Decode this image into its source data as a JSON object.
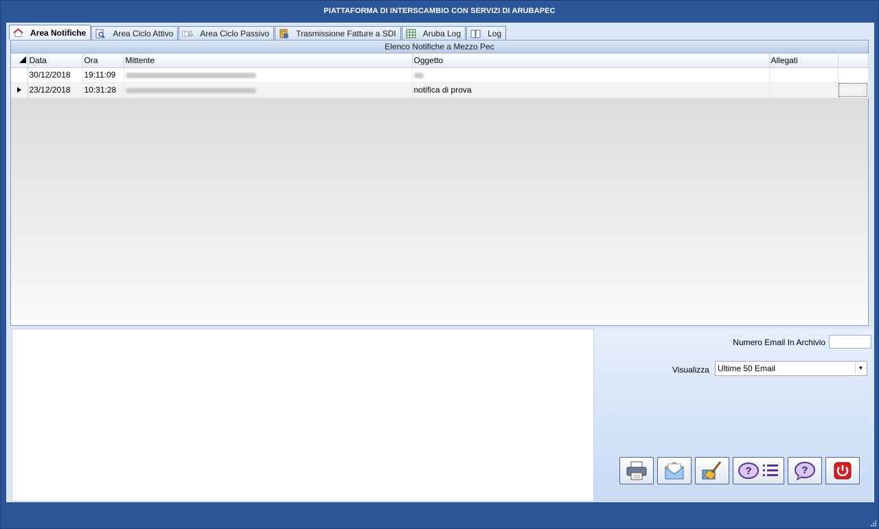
{
  "window": {
    "title": "PIATTAFORMA DI INTERSCAMBIO CON SERVIZI DI ARUBAPEC"
  },
  "tabs": [
    {
      "label": "Area Notifiche",
      "icon": "home-icon",
      "active": true
    },
    {
      "label": "Area Ciclo Attivo",
      "icon": "document-search-icon",
      "active": false
    },
    {
      "label": "Area Ciclo Passivo",
      "icon": "documents-arrow-icon",
      "active": false
    },
    {
      "label": "Trasmissione Fatture a SDI",
      "icon": "archive-icon",
      "active": false
    },
    {
      "label": "Aruba Log",
      "icon": "table-grid-icon",
      "active": false
    },
    {
      "label": "Log",
      "icon": "book-icon",
      "active": false
    }
  ],
  "grid": {
    "caption": "Elenco Notifiche a Mezzo Pec",
    "columns": [
      "Data",
      "Ora",
      "Mittente",
      "Oggetto",
      "Allegati"
    ],
    "rows": [
      {
        "data": "30/12/2018",
        "ora": "19:11:09",
        "mittente": "",
        "oggetto": "",
        "allegati": ""
      },
      {
        "data": "23/12/2018",
        "ora": "10:31:28",
        "mittente": "",
        "oggetto": "notifica di prova",
        "allegati": ""
      }
    ]
  },
  "archive": {
    "label": "Numero Email In Archivio",
    "value": ""
  },
  "view": {
    "label": "Visualizza",
    "selected": "Ultime 50 Email"
  },
  "toolbar": [
    {
      "icon": "printer-icon"
    },
    {
      "icon": "envelope-icon"
    },
    {
      "icon": "broom-icon"
    },
    {
      "icon": "help-list-icon"
    },
    {
      "icon": "help-icon"
    },
    {
      "icon": "power-icon"
    }
  ],
  "colors": {
    "frame": "#2b579a",
    "client": "#dbe7f6",
    "exit_red": "#d32027",
    "help_purple": "#5b2e91"
  }
}
